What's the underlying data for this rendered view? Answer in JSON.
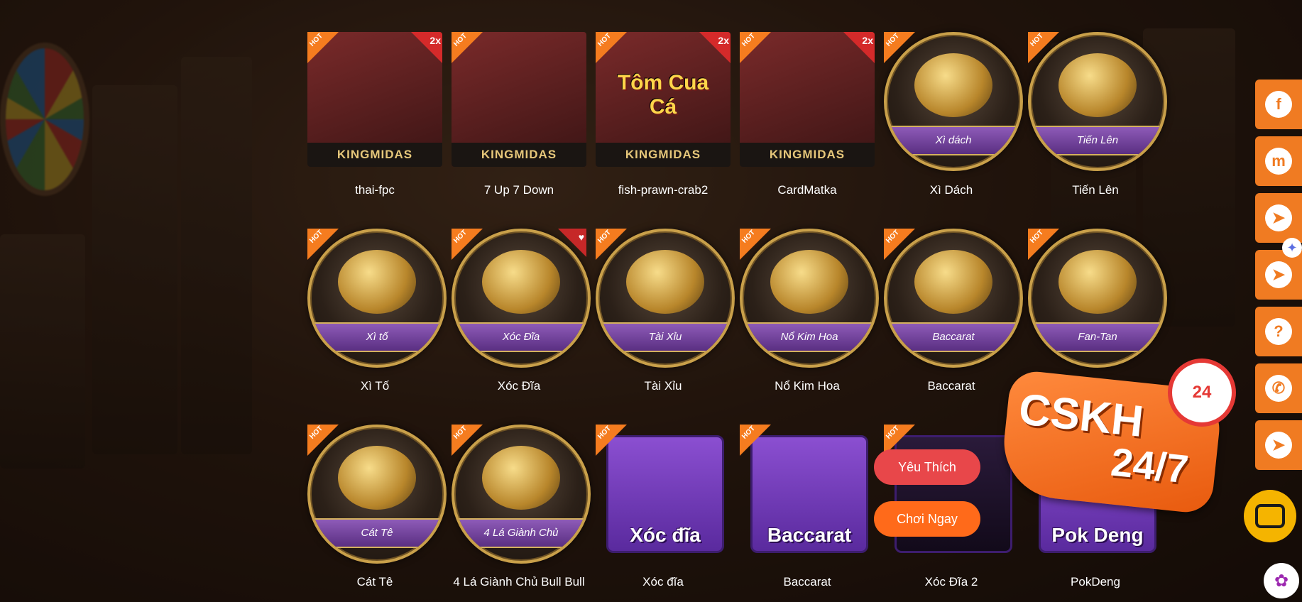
{
  "games": [
    {
      "name": "thai-fpc",
      "type": "tile",
      "tile_title": "",
      "hot": true,
      "bonus": "2x",
      "brand": "KINGMIDAS"
    },
    {
      "name": "7 Up 7 Down",
      "type": "tile",
      "tile_title": "",
      "hot": true,
      "bonus": "",
      "brand": "KINGMIDAS"
    },
    {
      "name": "fish-prawn-crab2",
      "type": "tile",
      "tile_title": "Tôm Cua Cá",
      "hot": true,
      "bonus": "2x",
      "brand": "KINGMIDAS"
    },
    {
      "name": "CardMatka",
      "type": "tile",
      "tile_title": "",
      "hot": true,
      "bonus": "2x",
      "brand": "KINGMIDAS"
    },
    {
      "name": "Xì Dách",
      "type": "round",
      "banner": "Xì dách",
      "hot": true
    },
    {
      "name": "Tiến Lên",
      "type": "round",
      "banner": "Tiến Lên",
      "hot": true
    },
    {
      "name": "Xì Tố",
      "type": "round",
      "banner": "Xì tố",
      "hot": true
    },
    {
      "name": "Xóc Đĩa",
      "type": "round",
      "banner": "Xóc Đĩa",
      "hot": true,
      "favorite": true
    },
    {
      "name": "Tài Xỉu",
      "type": "round",
      "banner": "Tài Xỉu",
      "hot": true
    },
    {
      "name": "Nổ Kim Hoa",
      "type": "round",
      "banner": "Nổ Kim Hoa",
      "hot": true
    },
    {
      "name": "Baccarat",
      "type": "round",
      "banner": "Baccarat",
      "hot": true
    },
    {
      "name": "Fan-Tan",
      "type": "round",
      "banner": "Fan-Tan",
      "hot": true
    },
    {
      "name": "Cát Tê",
      "type": "round",
      "banner": "Cát Tê",
      "hot": true
    },
    {
      "name": "4 Lá Giành Chủ Bull Bull",
      "type": "round",
      "banner": "4 Lá Giành Chủ",
      "hot": true
    },
    {
      "name": "Xóc đĩa",
      "type": "square",
      "square_label": "Xóc đĩa",
      "hot": true
    },
    {
      "name": "Baccarat",
      "type": "square",
      "square_label": "Baccarat",
      "hot": true
    },
    {
      "name": "Xóc Đĩa 2",
      "type": "square",
      "square_label": "",
      "hot": true
    },
    {
      "name": "PokDeng",
      "type": "square",
      "square_label": "Pok Deng",
      "hot": false
    }
  ],
  "labels": {
    "hot": "HOT",
    "favorite_button": "Yêu Thích",
    "play_button": "Chơi Ngay"
  },
  "cskh": {
    "title": "CSKH",
    "subtitle": "24/7",
    "clock_number": "24"
  },
  "sidebar": [
    {
      "icon": "facebook-icon",
      "glyph": "f"
    },
    {
      "icon": "messenger-icon",
      "glyph": "m"
    },
    {
      "icon": "telegram-icon",
      "glyph": "➤"
    },
    {
      "icon": "telegram-icon",
      "glyph": "➤"
    },
    {
      "icon": "help-icon",
      "glyph": "?"
    },
    {
      "icon": "phone-icon",
      "glyph": "✆"
    },
    {
      "icon": "telegram-icon",
      "glyph": "➤"
    }
  ],
  "colors": {
    "accent": "#f07b22",
    "hot_badge": "#f57c1f",
    "favorite_button": "#e8474a",
    "play_button": "#ff6a1a",
    "banner_purple": "#8e5bb8",
    "gold_border": "#c9a04a"
  }
}
